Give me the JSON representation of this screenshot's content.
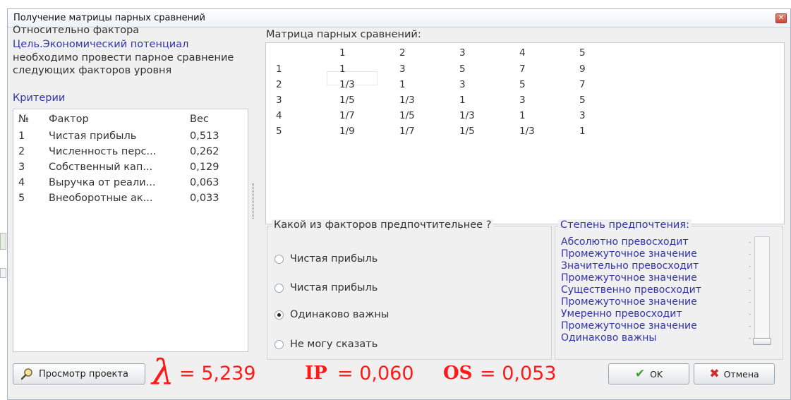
{
  "window": {
    "title": "Получение матрицы парных сравнений",
    "close_symbol": "✕"
  },
  "left_panel": {
    "relative_label": "Относительно фактора",
    "goal": "Цель.Экономический потенциал",
    "need_text": "необходимо провести парное сравнение следующих факторов уровня",
    "criteria_label": "Критерии",
    "columns": {
      "num": "№",
      "factor": "Фактор",
      "weight": "Вес"
    },
    "rows": [
      {
        "num": "1",
        "factor": "Чистая прибыль",
        "weight": "0,513"
      },
      {
        "num": "2",
        "factor": "Численность перс...",
        "weight": "0,262"
      },
      {
        "num": "3",
        "factor": "Собственный кап...",
        "weight": "0,129"
      },
      {
        "num": "4",
        "factor": "Выручка от реали...",
        "weight": "0,063"
      },
      {
        "num": "5",
        "factor": "Внеоборотные ак...",
        "weight": "0,033"
      }
    ]
  },
  "matrix": {
    "title": "Матрица парных сравнений:",
    "col_headers": [
      "1",
      "2",
      "3",
      "4",
      "5"
    ],
    "row_headers": [
      "1",
      "2",
      "3",
      "4",
      "5"
    ],
    "cells": [
      [
        "1",
        "3",
        "5",
        "7",
        "9"
      ],
      [
        "1/3",
        "1",
        "3",
        "5",
        "7"
      ],
      [
        "1/5",
        "1/3",
        "1",
        "3",
        "5"
      ],
      [
        "1/7",
        "1/5",
        "1/3",
        "1",
        "3"
      ],
      [
        "1/9",
        "1/7",
        "1/5",
        "1/3",
        "1"
      ]
    ]
  },
  "preference": {
    "legend": "Какой из факторов предпочтительнее ?",
    "options": [
      {
        "label": "Чистая прибыль",
        "checked": false
      },
      {
        "label": "Чистая прибыль",
        "checked": false
      },
      {
        "label": "Одинаково важны",
        "checked": true
      },
      {
        "label": "Не могу сказать",
        "checked": false
      }
    ]
  },
  "degree": {
    "legend": "Степень предпочтения:",
    "items": [
      "Абсолютно превосходит",
      "Промежуточное значение",
      "Значительно превосходит",
      "Промежуточное значение",
      "Существенно превосходит",
      "Промежуточное значение",
      "Умеренно превосходит",
      "Промежуточное значение",
      "Одинаково важны"
    ],
    "selected_index": 8
  },
  "footer": {
    "view_project_label": "Просмотр проекта",
    "lambda_symbol": "λ",
    "lambda_text": "= 5,239",
    "ip_label": "IP",
    "ip_value": "= 0,060",
    "os_label": "OS",
    "os_value": "= 0,053",
    "ok_label": "OK",
    "cancel_label": "Отмена"
  },
  "colors": {
    "accent_text": "#3333aa",
    "metric_red": "#ff1a1a"
  }
}
